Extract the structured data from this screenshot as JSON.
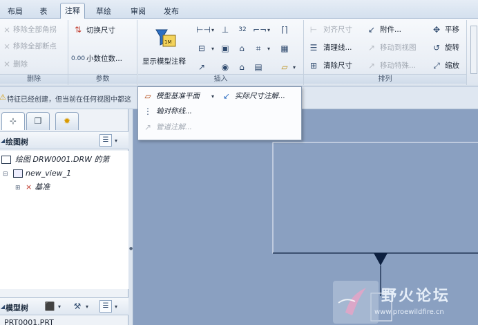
{
  "tabs": [
    "布局",
    "表",
    "注释",
    "草绘",
    "审阅",
    "发布"
  ],
  "active_tab": "注释",
  "ribbon": {
    "groups": {
      "delete": {
        "label": "删除",
        "items": [
          "移除全部角拐",
          "移除全部断点",
          "删除"
        ]
      },
      "params": {
        "label": "参数",
        "items": [
          "切换尺寸",
          "小数位数..."
        ]
      },
      "insert": {
        "label": "插入",
        "show_model_annotations": "显示模型注释"
      },
      "arrange": {
        "label": "排列",
        "items": [
          "对齐尺寸",
          "附件...",
          "平移",
          "清理线...",
          "移动到视图",
          "旋转",
          "清除尺寸",
          "移动特殊...",
          "缩放"
        ]
      }
    },
    "icon_labels": {
      "decimal_value": "0.00",
      "note_value": "32",
      "pos_value": "1M"
    }
  },
  "message_bar": {
    "text": "特征已经创建，但当前在任何视图中都这"
  },
  "popup": {
    "items": [
      "模型基准平面",
      "实际尺寸注解...",
      "轴对称线...",
      "管道注解..."
    ]
  },
  "left_panel": {
    "tab_icons": [
      "tree-icon",
      "layers-icon",
      "star-icon"
    ],
    "drawing_tree": {
      "title": "绘图树",
      "items": [
        "绘图 DRW0001.DRW 的第",
        "new_view_1",
        "基准"
      ]
    },
    "model_tree": {
      "title": "模型树",
      "first_item": "PRT0001.PRT"
    }
  },
  "watermark": {
    "title": "野火论坛",
    "url": "www.proewildfire.cn"
  },
  "colors": {
    "canvas_bg": "#8aa0c1",
    "drawing_line": "#0d2040",
    "accent": "#2f4a6e"
  }
}
